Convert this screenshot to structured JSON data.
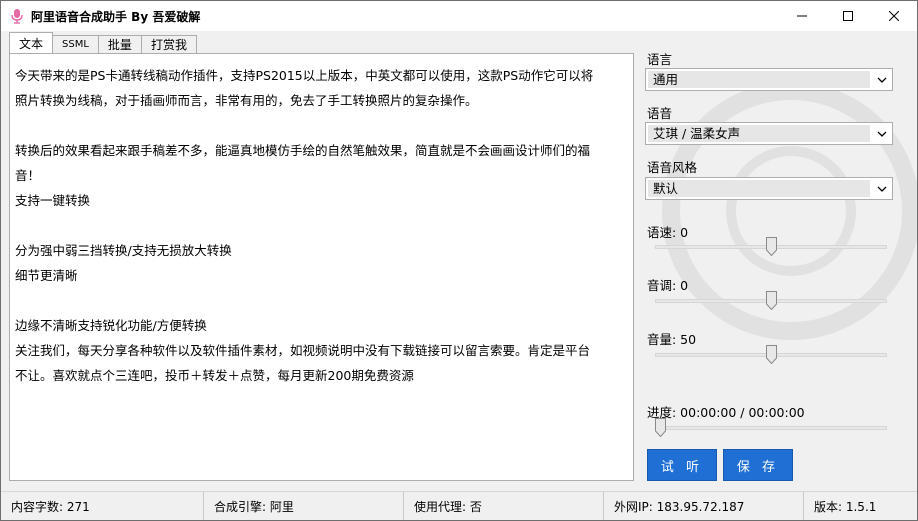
{
  "window": {
    "title": "阿里语音合成助手 By 吾爱破解"
  },
  "tabs": [
    {
      "label": "文本",
      "active": true
    },
    {
      "label": "SSML",
      "active": false
    },
    {
      "label": "批量",
      "active": false
    },
    {
      "label": "打赏我",
      "active": false
    }
  ],
  "editor": {
    "lines": [
      "今天带来的是PS卡通转线稿动作插件，支持PS2015以上版本，中英文都可以使用，这款PS动作它可以将",
      "照片转换为线稿，对于插画师而言，非常有用的，免去了手工转换照片的复杂操作。",
      "",
      "转换后的效果看起来跟手稿差不多，能逼真地模仿手绘的自然笔触效果，简直就是不会画画设计师们的福",
      "音！",
      "支持一键转换",
      "",
      "分为强中弱三挡转换/支持无损放大转换",
      "细节更清晰",
      "",
      "边缘不清晰支持锐化功能/方便转换",
      "关注我们，每天分享各种软件以及软件插件素材，如视频说明中没有下载链接可以留言索要。肯定是平台",
      "不让。喜欢就点个三连吧，投币＋转发＋点赞，每月更新200期免费资源"
    ]
  },
  "settings": {
    "language_label": "语言",
    "language_value": "通用",
    "voice_label": "语音",
    "voice_value": "艾琪 / 温柔女声",
    "style_label": "语音风格",
    "style_value": "默认",
    "speed_label": "语速: 0",
    "speed_level": 0.5,
    "pitch_label": "音调: 0",
    "pitch_level": 0.5,
    "volume_label": "音量: 50",
    "volume_level": 0.5,
    "progress_label": "进度: 00:00:00 / 00:00:00",
    "progress_level": 0.0
  },
  "buttons": {
    "preview": "试 听",
    "save": "保 存"
  },
  "status": {
    "char_count": "内容字数: 271",
    "engine": "合成引擎: 阿里",
    "proxy": "使用代理: 否",
    "ip": "外网IP: 183.95.72.187",
    "version": "版本: 1.5.1"
  },
  "colors": {
    "accent_button": "#1f6fd4",
    "window_bg": "#f0f0f0",
    "icon_pink": "#e46aa8"
  }
}
